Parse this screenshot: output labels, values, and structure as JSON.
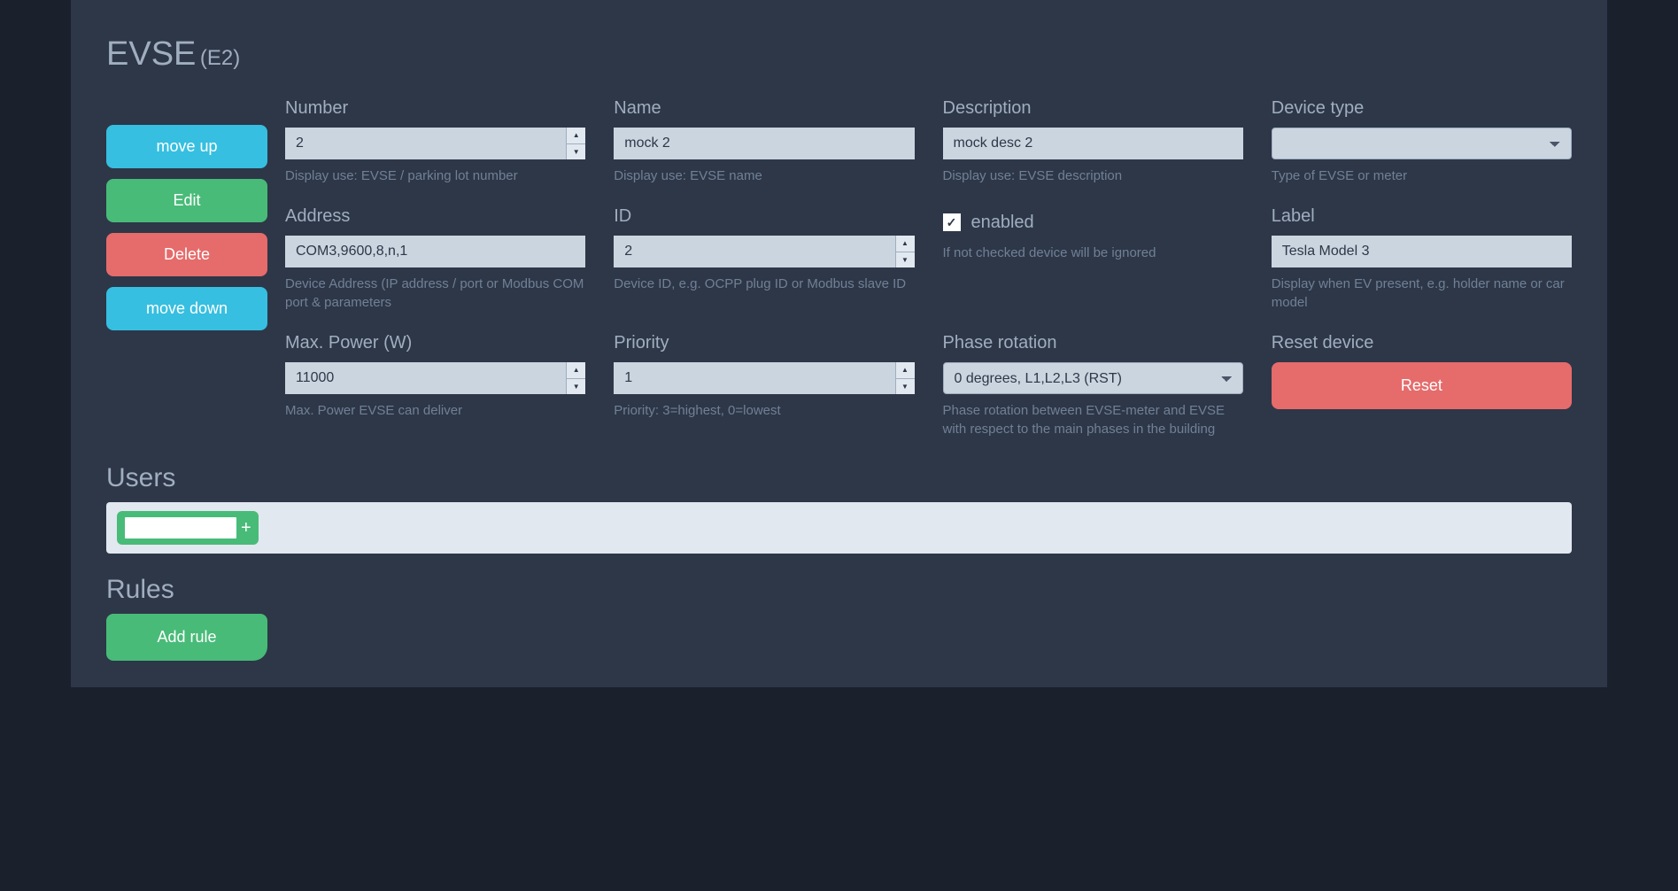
{
  "header": {
    "title": "EVSE",
    "subtitle": "(E2)"
  },
  "sideButtons": {
    "moveUp": "move up",
    "edit": "Edit",
    "delete": "Delete",
    "moveDown": "move down"
  },
  "fields": {
    "number": {
      "label": "Number",
      "value": "2",
      "help": "Display use: EVSE / parking lot number"
    },
    "name": {
      "label": "Name",
      "value": "mock 2",
      "help": "Display use: EVSE name"
    },
    "description": {
      "label": "Description",
      "value": "mock desc 2",
      "help": "Display use: EVSE description"
    },
    "deviceType": {
      "label": "Device type",
      "value": "",
      "help": "Type of EVSE or meter"
    },
    "address": {
      "label": "Address",
      "value": "COM3,9600,8,n,1",
      "help": "Device Address (IP address / port or Modbus COM port & parameters"
    },
    "id": {
      "label": "ID",
      "value": "2",
      "help": "Device ID, e.g. OCPP plug ID or Modbus slave ID"
    },
    "enabled": {
      "label": "enabled",
      "checked": true,
      "help": "If not checked device will be ignored"
    },
    "label": {
      "label": "Label",
      "value": "Tesla Model 3",
      "help": "Display when EV present, e.g. holder name or car model"
    },
    "maxPower": {
      "label": "Max. Power (W)",
      "value": "11000",
      "help": "Max. Power EVSE can deliver"
    },
    "priority": {
      "label": "Priority",
      "value": "1",
      "help": "Priority: 3=highest, 0=lowest"
    },
    "phaseRotation": {
      "label": "Phase rotation",
      "value": "0 degrees, L1,L2,L3 (RST)",
      "help": "Phase rotation between EVSE-meter and EVSE with respect to the main phases in the building"
    },
    "resetDevice": {
      "label": "Reset device",
      "button": "Reset"
    }
  },
  "users": {
    "title": "Users",
    "addIcon": "+"
  },
  "rules": {
    "title": "Rules",
    "addButton": "Add rule"
  }
}
